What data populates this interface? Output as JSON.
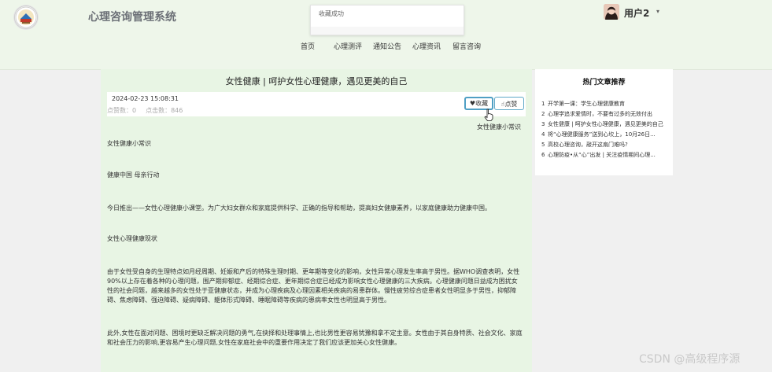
{
  "header": {
    "site_title": "心理咨询管理系统",
    "toast": "收藏成功",
    "username": "用户2",
    "user_caret": "▾"
  },
  "nav": [
    "首页",
    "心理测评",
    "通知公告",
    "心理资讯",
    "留言咨询"
  ],
  "article": {
    "title": "女性健康 | 呵护女性心理健康，遇见更美的自己",
    "date": "2024-02-23 15:08:31",
    "likes": "点赞数：0",
    "clicks": "点击数：846",
    "fav_label": "收藏",
    "like_label": "点赞",
    "category": "女性健康小常识",
    "paragraphs": [
      "女性健康小常识",
      "健康中国 母亲行动",
      "今日推出——女性心理健康小课堂。为广大妇女群众和家庭提供科学、正确的指导和帮助，提高妇女健康素养，以家庭健康助力健康中国。",
      "女性心理健康现状",
      "由于女性受自身的生理特点如月经周期、妊娠和产后的特殊生理时期、更年期等变化的影响，女性异常心理发生率高于男性。据WHO调查表明，女性90%以上存在着各种的心理问题，围产期抑郁症、经期综合症、更年期综合症已经成为影响女性心理健康的三大疾病。心理健康问题日益成为困扰女性的社会问题，越来越多的女性处于亚健康状态，并成为心理疾病及心理因素相关疾病的易患群体。慢性疲劳综合症患者女性明显多于男性，抑郁障碍、焦虑障碍、强迫障碍、疑病障碍、躯体形式障碍、睡眠障碍等疾病的患病率女性也明显高于男性。",
      "此外,女性在面对问题、困境时更缺乏解决问题的勇气,在抉择和处理事情上,也比男性更容易犹豫和拿不定主意。女性由于其自身特质、社会文化、家庭和社会压力的影响,更容易产生心理问题,女性在家庭社会中的重要作用决定了我们应该更加关心女性健康。"
    ]
  },
  "sidebar": {
    "title": "热门文章推荐",
    "items": [
      {
        "num": "1",
        "text": "开学第一课：学生心理健康教育"
      },
      {
        "num": "2",
        "text": "心理学追求爱情时，不要有过多的无效付出"
      },
      {
        "num": "3",
        "text": "女性健康 | 呵护女性心理健康，遇见更美的自己"
      },
      {
        "num": "4",
        "text": "将“心理健康服务”送到心坎上，10月26日..."
      },
      {
        "num": "5",
        "text": "高校心理咨询，敲开这扇门难吗?"
      },
      {
        "num": "6",
        "text": "心理防疫•从“心”出发 | 关注疫情期间心理..."
      }
    ]
  },
  "watermark": "CSDN @高级程序源",
  "colors": {
    "accent": "#4f9fc4",
    "header_bg": "#eef6ea",
    "main_bg": "#e8f5e4"
  }
}
